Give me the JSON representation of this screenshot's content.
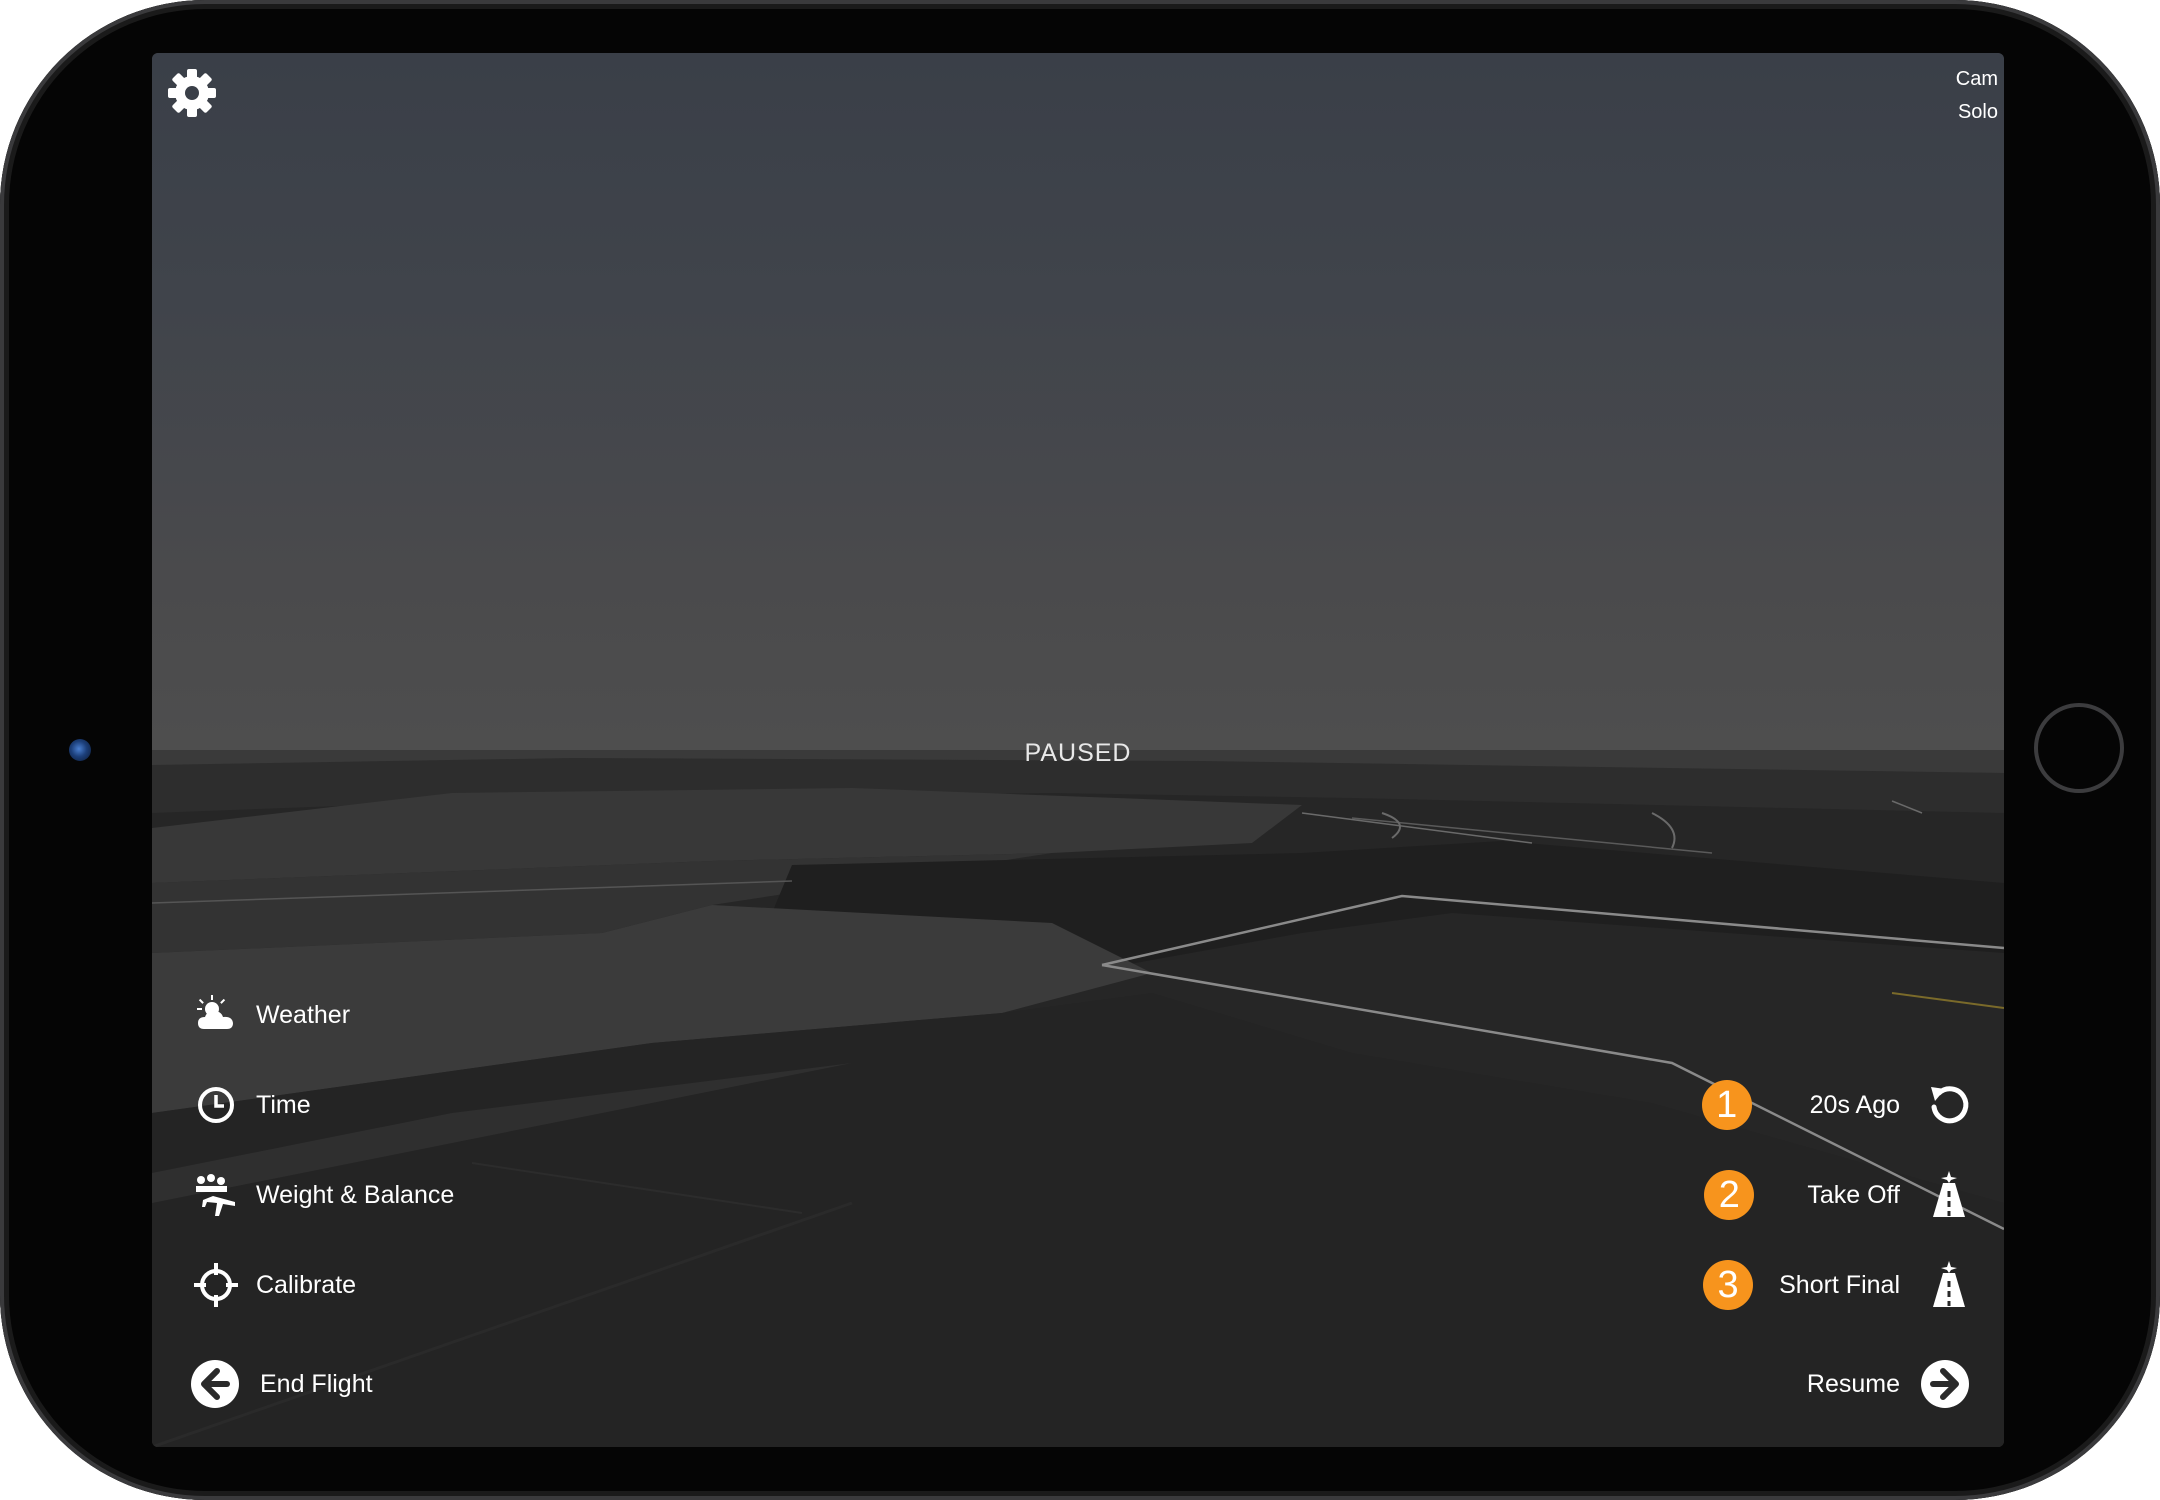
{
  "status": {
    "paused_text": "PAUSED"
  },
  "camera": {
    "line1": "Cam",
    "line2": "Solo"
  },
  "settings": {
    "icon": "gear-icon"
  },
  "menu": {
    "items": [
      {
        "label": "Weather",
        "icon": "weather-icon"
      },
      {
        "label": "Time",
        "icon": "clock-icon"
      },
      {
        "label": "Weight & Balance",
        "icon": "weight-balance-icon"
      },
      {
        "label": "Calibrate",
        "icon": "crosshair-icon"
      }
    ]
  },
  "restore_points": [
    {
      "number": "1",
      "label": "20s Ago",
      "icon": "rewind-icon"
    },
    {
      "number": "2",
      "label": "Take Off",
      "icon": "runway-icon"
    },
    {
      "number": "3",
      "label": "Short Final",
      "icon": "runway-icon"
    }
  ],
  "nav": {
    "end_flight": "End Flight",
    "resume": "Resume"
  },
  "colors": {
    "badge": "#f7941d",
    "text": "#ffffff",
    "device": "#050505"
  }
}
